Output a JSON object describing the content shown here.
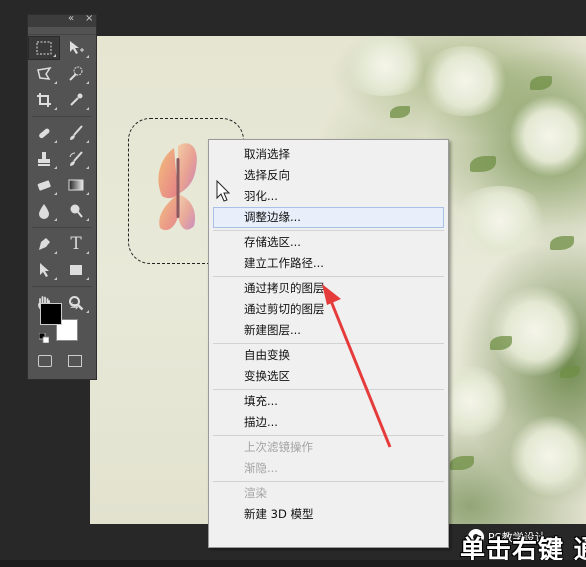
{
  "toolbar": {
    "collapse_glyph": "«",
    "close_glyph": "×",
    "tools": [
      [
        "marquee-icon",
        "move-icon"
      ],
      [
        "lasso-icon",
        "quick-select-icon"
      ],
      [
        "crop-icon",
        "eyedropper-icon"
      ],
      [
        "healing-brush-icon",
        "brush-icon"
      ],
      [
        "clone-stamp-icon",
        "history-brush-icon"
      ],
      [
        "eraser-icon",
        "gradient-icon"
      ],
      [
        "blur-icon",
        "dodge-icon"
      ],
      [
        "pen-icon",
        "type-icon"
      ],
      [
        "path-select-icon",
        "rectangle-shape-icon"
      ],
      [
        "hand-icon",
        "zoom-icon"
      ]
    ],
    "type_glyph": "T",
    "swap_glyph": "⇆",
    "foreground_color": "#000000",
    "background_color": "#ffffff"
  },
  "context_menu": {
    "groups": [
      [
        {
          "label": "取消选择",
          "enabled": true
        },
        {
          "label": "选择反向",
          "enabled": true
        },
        {
          "label": "羽化...",
          "enabled": true
        },
        {
          "label": "调整边缘...",
          "enabled": true,
          "highlighted": true
        }
      ],
      [
        {
          "label": "存储选区...",
          "enabled": true
        },
        {
          "label": "建立工作路径...",
          "enabled": true
        }
      ],
      [
        {
          "label": "通过拷贝的图层",
          "enabled": true
        },
        {
          "label": "通过剪切的图层",
          "enabled": true
        },
        {
          "label": "新建图层...",
          "enabled": true
        }
      ],
      [
        {
          "label": "自由变换",
          "enabled": true
        },
        {
          "label": "变换选区",
          "enabled": true
        }
      ],
      [
        {
          "label": "填充...",
          "enabled": true
        },
        {
          "label": "描边...",
          "enabled": true
        }
      ],
      [
        {
          "label": "上次滤镜操作",
          "enabled": false
        },
        {
          "label": "渐隐...",
          "enabled": false
        }
      ],
      [
        {
          "label": "渲染",
          "enabled": false
        },
        {
          "label": "新建 3D 模型",
          "enabled": true
        }
      ]
    ]
  },
  "annotation": {
    "arrow_color": "#e53b3b"
  },
  "watermark": {
    "text": "PS教学设计"
  },
  "subtitle": {
    "text": "单击右键 通"
  }
}
